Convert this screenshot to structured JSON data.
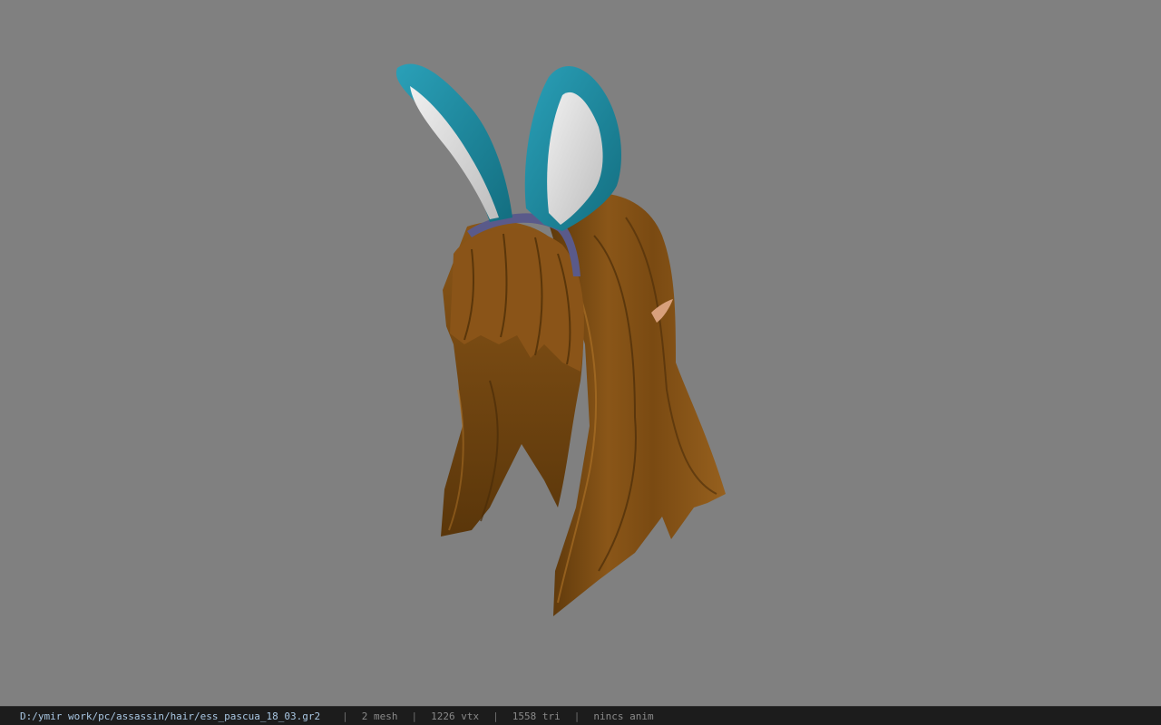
{
  "status_bar": {
    "file_path": "D:/ymir work/pc/assassin/hair/ess_pascua_18_03.gr2",
    "separator": "|",
    "mesh_count": "2 mesh",
    "vertex_count": "1226 vtx",
    "triangle_count": "1558 tri",
    "animation": "nincs anim"
  },
  "viewport": {
    "background_color": "#808080"
  },
  "model": {
    "hair_color": "#7a4a12",
    "ear_color": "#1e8ca3",
    "ear_inner_color": "#d8d8d8",
    "band_color": "#5a5a8a",
    "ear_tip_color": "#d8a07c"
  }
}
